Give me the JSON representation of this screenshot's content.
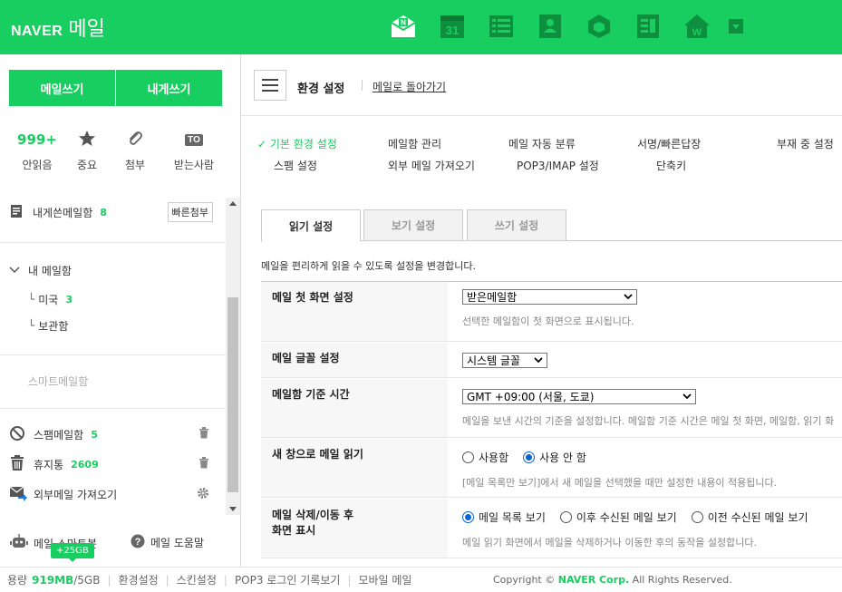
{
  "header": {
    "brand": "NAVER",
    "app_name": "메일",
    "brand_color": "#19ce60",
    "apps": [
      "mail-app-icon",
      "calendar-app-icon",
      "todo-app-icon",
      "contacts-app-icon",
      "box-app-icon",
      "memo-app-icon",
      "home-app-icon",
      "more-dropdown-icon"
    ],
    "calendar_day": "31"
  },
  "sidebar": {
    "write_label": "메일쓰기",
    "self_write_label": "내게쓰기",
    "quick": [
      {
        "count": "999+",
        "label": "안읽음"
      },
      {
        "icon": "star-icon",
        "label": "중요"
      },
      {
        "icon": "clip-icon",
        "label": "첨부"
      },
      {
        "badge": "TO",
        "label": "받는사람"
      }
    ],
    "self_folder": {
      "name": "내게쓴메일함",
      "count": "8",
      "button": "빠른첨부"
    },
    "my_folders_title": "내 메일함",
    "my_folders": [
      {
        "name": "미국",
        "count": "3"
      },
      {
        "name": "보관함",
        "count": ""
      }
    ],
    "smart_folder": "스마트메일함",
    "system_folders": [
      {
        "name": "스팸메일함",
        "count": "5"
      },
      {
        "name": "휴지통",
        "count": "2609"
      },
      {
        "name": "외부메일 가져오기",
        "count": ""
      }
    ],
    "bottom_links": [
      "메일 스마트봇",
      "메일 도움말"
    ],
    "storage_tip": "+25GB"
  },
  "footer": {
    "storage_label": "용량",
    "storage_used": "919MB",
    "storage_total": "/5GB",
    "links": [
      "환경설정",
      "스킨설정",
      "POP3 로그인 기록보기",
      "모바일 메일"
    ],
    "copyright_prefix": "Copyright ©",
    "copyright_corp": "NAVER Corp.",
    "copyright_suffix": "All Rights Reserved."
  },
  "main": {
    "title": "환경 설정",
    "back_link": "메일로 돌아가기",
    "settings_nav": [
      {
        "label": "기본 환경 설정",
        "active": true
      },
      {
        "label": "메일함 관리"
      },
      {
        "label": "메일 자동 분류"
      },
      {
        "label": "서명/빠른답장"
      },
      {
        "label": "부재 중 설정"
      },
      {
        "label": "스팸 설정"
      },
      {
        "label": "외부 메일 가져오기"
      },
      {
        "label": "POP3/IMAP 설정"
      },
      {
        "label": "단축키"
      }
    ],
    "tabs": [
      "읽기 설정",
      "보기 설정",
      "쓰기 설정"
    ],
    "description": "메일을 편리하게 읽을 수 있도록 설정을 변경합니다.",
    "rows": [
      {
        "label": "메일 첫 화면 설정",
        "select": "받은메일함",
        "hint": "선택한 메일함이 첫 화면으로 표시됩니다."
      },
      {
        "label": "메일 글꼴 설정",
        "select": "시스템 글꼴"
      },
      {
        "label": "메일함 기준 시간",
        "select": "GMT +09:00 (서울, 도쿄)",
        "hint": "메일을 보낸 시간의 기준을 설정합니다. 메일함 기준 시간은 메일 첫 화면, 메일함, 읽기 화"
      },
      {
        "label": "새 창으로 메일 읽기",
        "options": [
          "사용함",
          "사용 안 함"
        ],
        "selected": 1,
        "hint": "[메일 목록만 보기]에서 새 메일을 선택했을 때만 설정한 내용이 적용됩니다."
      },
      {
        "label": "메일 삭제/이동 후 화면 표시",
        "label_line1": "메일 삭제/이동 후",
        "label_line2": "화면 표시",
        "options": [
          "메일 목록 보기",
          "이후 수신된 메일 보기",
          "이전 수신된 메일 보기"
        ],
        "selected": 0,
        "hint": "메일 읽기 화면에서 메일을 삭제하거나 이동한 후의 동작을 설정합니다."
      }
    ]
  }
}
